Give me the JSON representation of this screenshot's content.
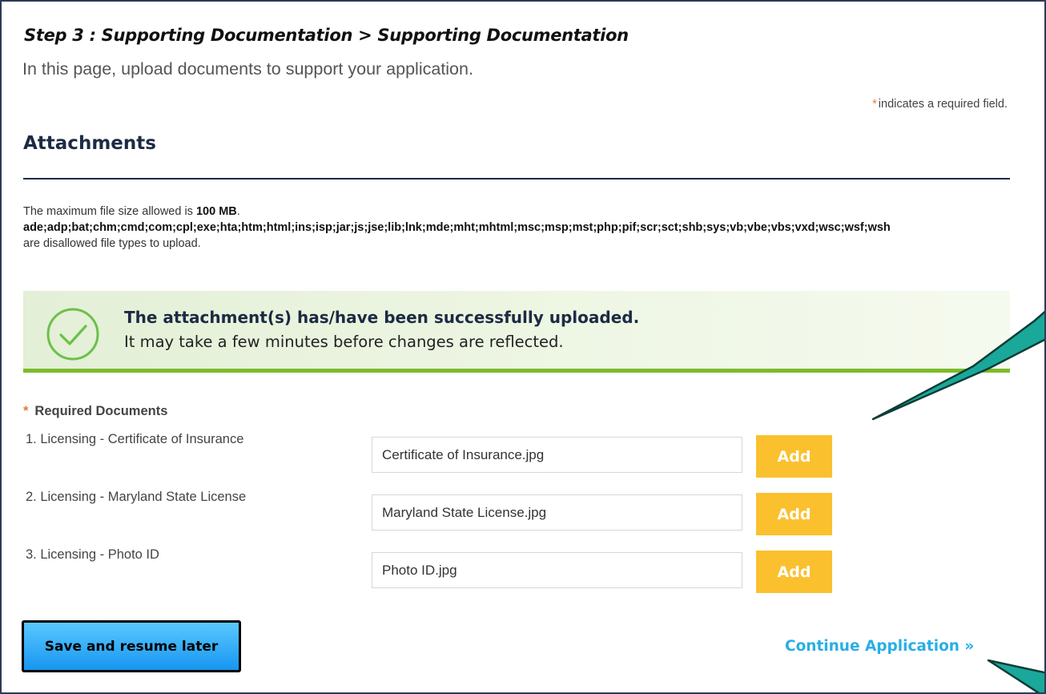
{
  "header": {
    "step_title": "Step 3 : Supporting Documentation > Supporting Documentation",
    "subtitle": "In this page, upload documents to support your application."
  },
  "required_note": {
    "star": "*",
    "text": "indicates a required field."
  },
  "section_title": "Attachments",
  "file_info": {
    "max_prefix": "The maximum file size allowed is ",
    "max_size": "100 MB",
    "max_suffix": ".",
    "disallowed_types": "ade;adp;bat;chm;cmd;com;cpl;exe;hta;htm;html;ins;isp;jar;js;jse;lib;lnk;mde;mht;mhtml;msc;msp;mst;php;pif;scr;sct;shb;sys;vb;vbe;vbs;vxd;wsc;wsf;wsh",
    "disallowed_suffix": "are disallowed file types to upload."
  },
  "success_banner": {
    "title": "The attachment(s) has/have been successfully uploaded.",
    "message": "It may take a few minutes before changes are reflected.",
    "icon": "check-circle-icon",
    "accent_color": "#7cbb2a"
  },
  "documents": {
    "star": "*",
    "heading": "Required Documents",
    "add_label": "Add",
    "items": [
      {
        "label": "1. Licensing - Certificate of Insurance",
        "value": "Certificate of Insurance.jpg"
      },
      {
        "label": "2. Licensing - Maryland State License",
        "value": "Maryland State License.jpg"
      },
      {
        "label": "3. Licensing - Photo ID",
        "value": "Photo ID.jpg"
      }
    ]
  },
  "actions": {
    "save_label": "Save and resume later",
    "continue_label": "Continue Application »"
  },
  "colors": {
    "add_button": "#fbc02d",
    "save_button": "#1796f0",
    "continue_link": "#29aee6",
    "callout": "#1aa89a"
  }
}
